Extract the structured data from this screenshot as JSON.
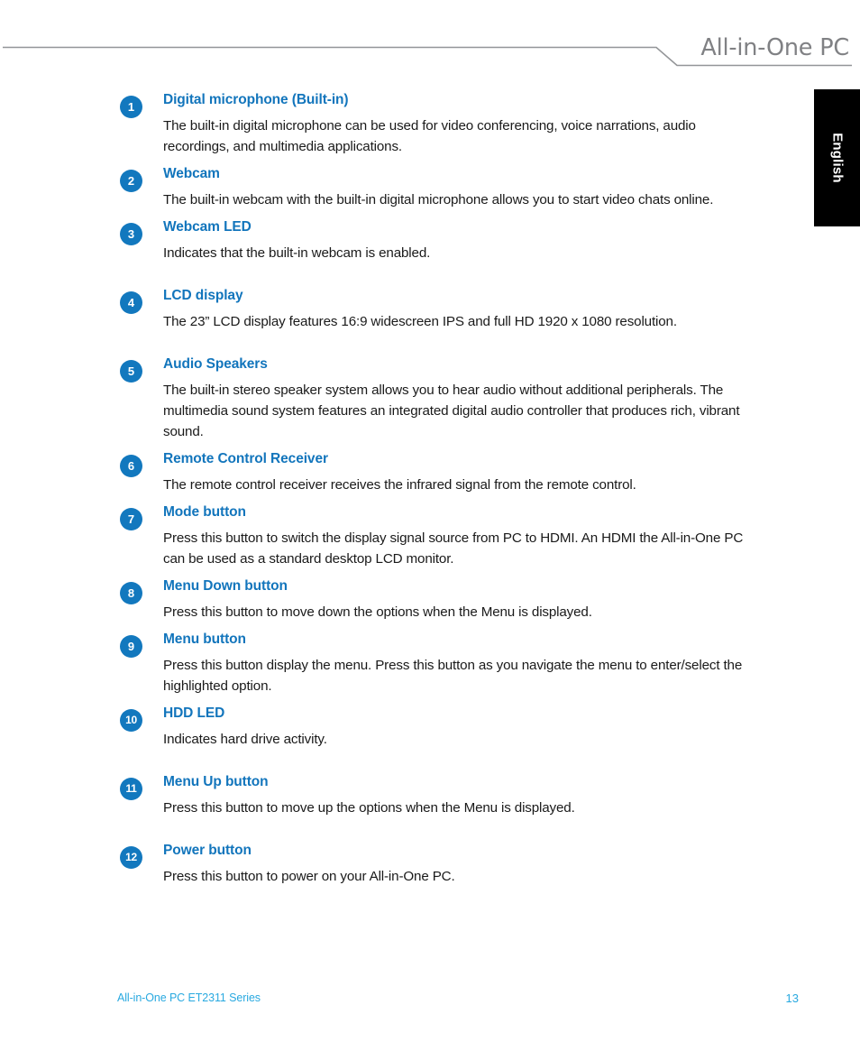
{
  "header": {
    "title": "All-in-One PC",
    "rule_color": "#939598"
  },
  "language_tab": {
    "label": "English",
    "background": "#000000",
    "text_color": "#ffffff"
  },
  "theme": {
    "heading_blue": "#1275BC",
    "badge_blue": "#1278BE",
    "footer_blue": "#29A9E0",
    "body_text": "#1A1A1A"
  },
  "items": [
    {
      "number": "1",
      "title": "Digital microphone (Built-in)",
      "body": "The built-in digital microphone can be used for video conferencing, voice narrations, audio recordings, and multimedia applications."
    },
    {
      "number": "2",
      "title": "Webcam",
      "body": "The built-in webcam with the built-in digital microphone allows you to start video chats online."
    },
    {
      "number": "3",
      "title": "Webcam LED",
      "body": "Indicates that the built-in webcam is enabled."
    },
    {
      "number": "4",
      "title": "LCD display",
      "body": "The 23” LCD display features 16:9 widescreen IPS and full HD 1920 x 1080 resolution."
    },
    {
      "number": "5",
      "title": "Audio Speakers",
      "body": "The built-in stereo speaker system allows you to hear audio without additional peripherals. The multimedia sound system features an integrated digital audio controller that produces rich, vibrant sound."
    },
    {
      "number": "6",
      "title": "Remote Control Receiver",
      "body": "The remote control receiver receives the infrared signal from the remote control."
    },
    {
      "number": "7",
      "title": "Mode button",
      "body": "Press this button to switch the display signal source from PC to HDMI. An HDMI the All-in-One PC can be used as a standard desktop LCD monitor."
    },
    {
      "number": "8",
      "title": "Menu Down button",
      "body": "Press this button to move down the options when the Menu is displayed."
    },
    {
      "number": "9",
      "title": "Menu button",
      "body": "Press this button display the menu. Press this button as you navigate the menu to enter/select the highlighted option."
    },
    {
      "number": "10",
      "title": "HDD LED",
      "body": "Indicates hard drive activity."
    },
    {
      "number": "11",
      "title": "Menu Up button",
      "body": "Press this button to move up the options when the Menu is displayed."
    },
    {
      "number": "12",
      "title": "Power button",
      "body": "Press this button to power on your All-in-One PC."
    }
  ],
  "footer": {
    "left_text": "All-in-One PC ET2311 Series",
    "page_number": "13"
  }
}
